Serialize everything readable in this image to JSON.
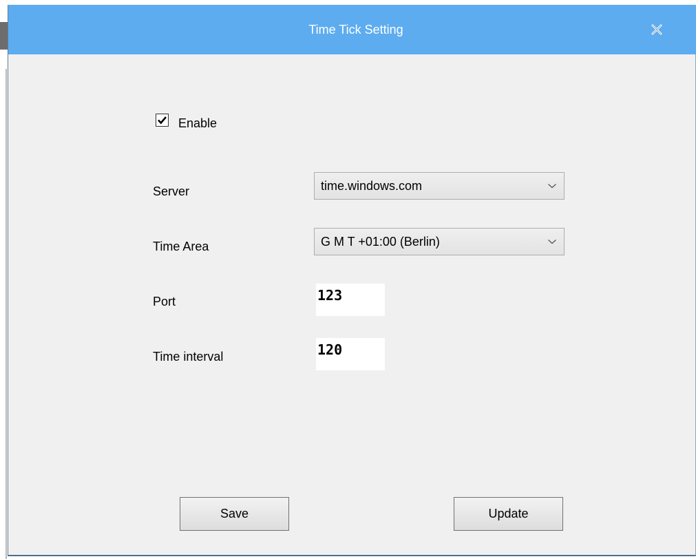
{
  "window": {
    "title": "Time Tick Setting",
    "close_icon": "close-icon",
    "titlebar_color": "#5dacf0"
  },
  "form": {
    "enable": {
      "label": "Enable",
      "checked": true
    },
    "server": {
      "label": "Server",
      "value": "time.windows.com"
    },
    "time_area": {
      "label": "Time Area",
      "value": "G M T +01:00 (Berlin)"
    },
    "port": {
      "label": "Port",
      "value": "123"
    },
    "time_interval": {
      "label": "Time interval",
      "value": "120"
    }
  },
  "buttons": {
    "save": "Save",
    "update": "Update"
  }
}
